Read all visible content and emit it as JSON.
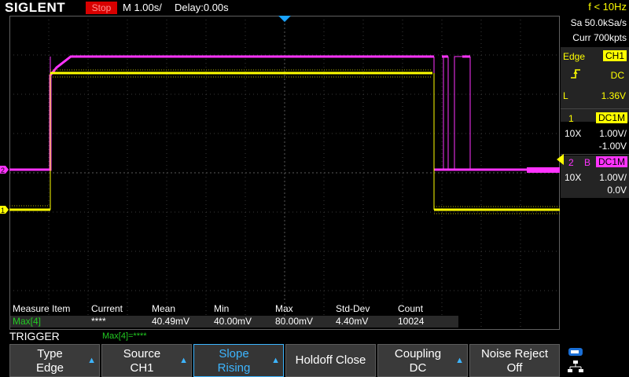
{
  "header": {
    "brand": "SIGLENT",
    "run_state": "Stop",
    "timebase": "M 1.00s/",
    "delay": "Delay:0.00s",
    "frequency": "f < 10Hz"
  },
  "acquisition": {
    "sample_rate": "Sa 50.0kSa/s",
    "memory": "Curr 700kpts"
  },
  "trigger": {
    "type_label": "Edge",
    "source_badge": "CH1",
    "coupling": "DC",
    "level_prefix": "L",
    "level": "1.36V"
  },
  "channels": [
    {
      "number": "1",
      "coupling_badge": "DC1M",
      "probe": "10X",
      "scale": "1.00V/",
      "offset": "-1.00V",
      "color": "#ffff00"
    },
    {
      "number": "2",
      "bw_flag": "B",
      "coupling_badge": "DC1M",
      "probe": "10X",
      "scale": "1.00V/",
      "offset": "0.0V",
      "color": "#ff33ff"
    }
  ],
  "markers": {
    "ch1": "1",
    "ch2": "2"
  },
  "measurement": {
    "headers": [
      "Measure Item",
      "Current",
      "Mean",
      "Min",
      "Max",
      "Std-Dev",
      "Count"
    ],
    "row": [
      "Max[4]",
      "****",
      "40.49mV",
      "40.00mV",
      "80.00mV",
      "4.40mV",
      "10024"
    ],
    "summary": "Max[4]=****"
  },
  "menu": {
    "title": "TRIGGER",
    "buttons": [
      {
        "line1": "Type",
        "line2": "Edge"
      },
      {
        "line1": "Source",
        "line2": "CH1"
      },
      {
        "line1": "Slope",
        "line2": "Rising"
      },
      {
        "single": "Holdoff Close"
      },
      {
        "line1": "Coupling",
        "line2": "DC"
      },
      {
        "line1": "Noise Reject",
        "line2": "Off"
      }
    ]
  },
  "colors": {
    "ch1": "#ffff00",
    "ch2": "#ff33ff",
    "accent": "#3db5ff",
    "run_stop": "#d80000",
    "measure_green": "#22cc22"
  },
  "icons": {
    "trigger_position": "trigger-position-marker-icon",
    "rising_edge": "rising-edge-icon",
    "usb": "usb-icon",
    "network": "network-icon"
  }
}
